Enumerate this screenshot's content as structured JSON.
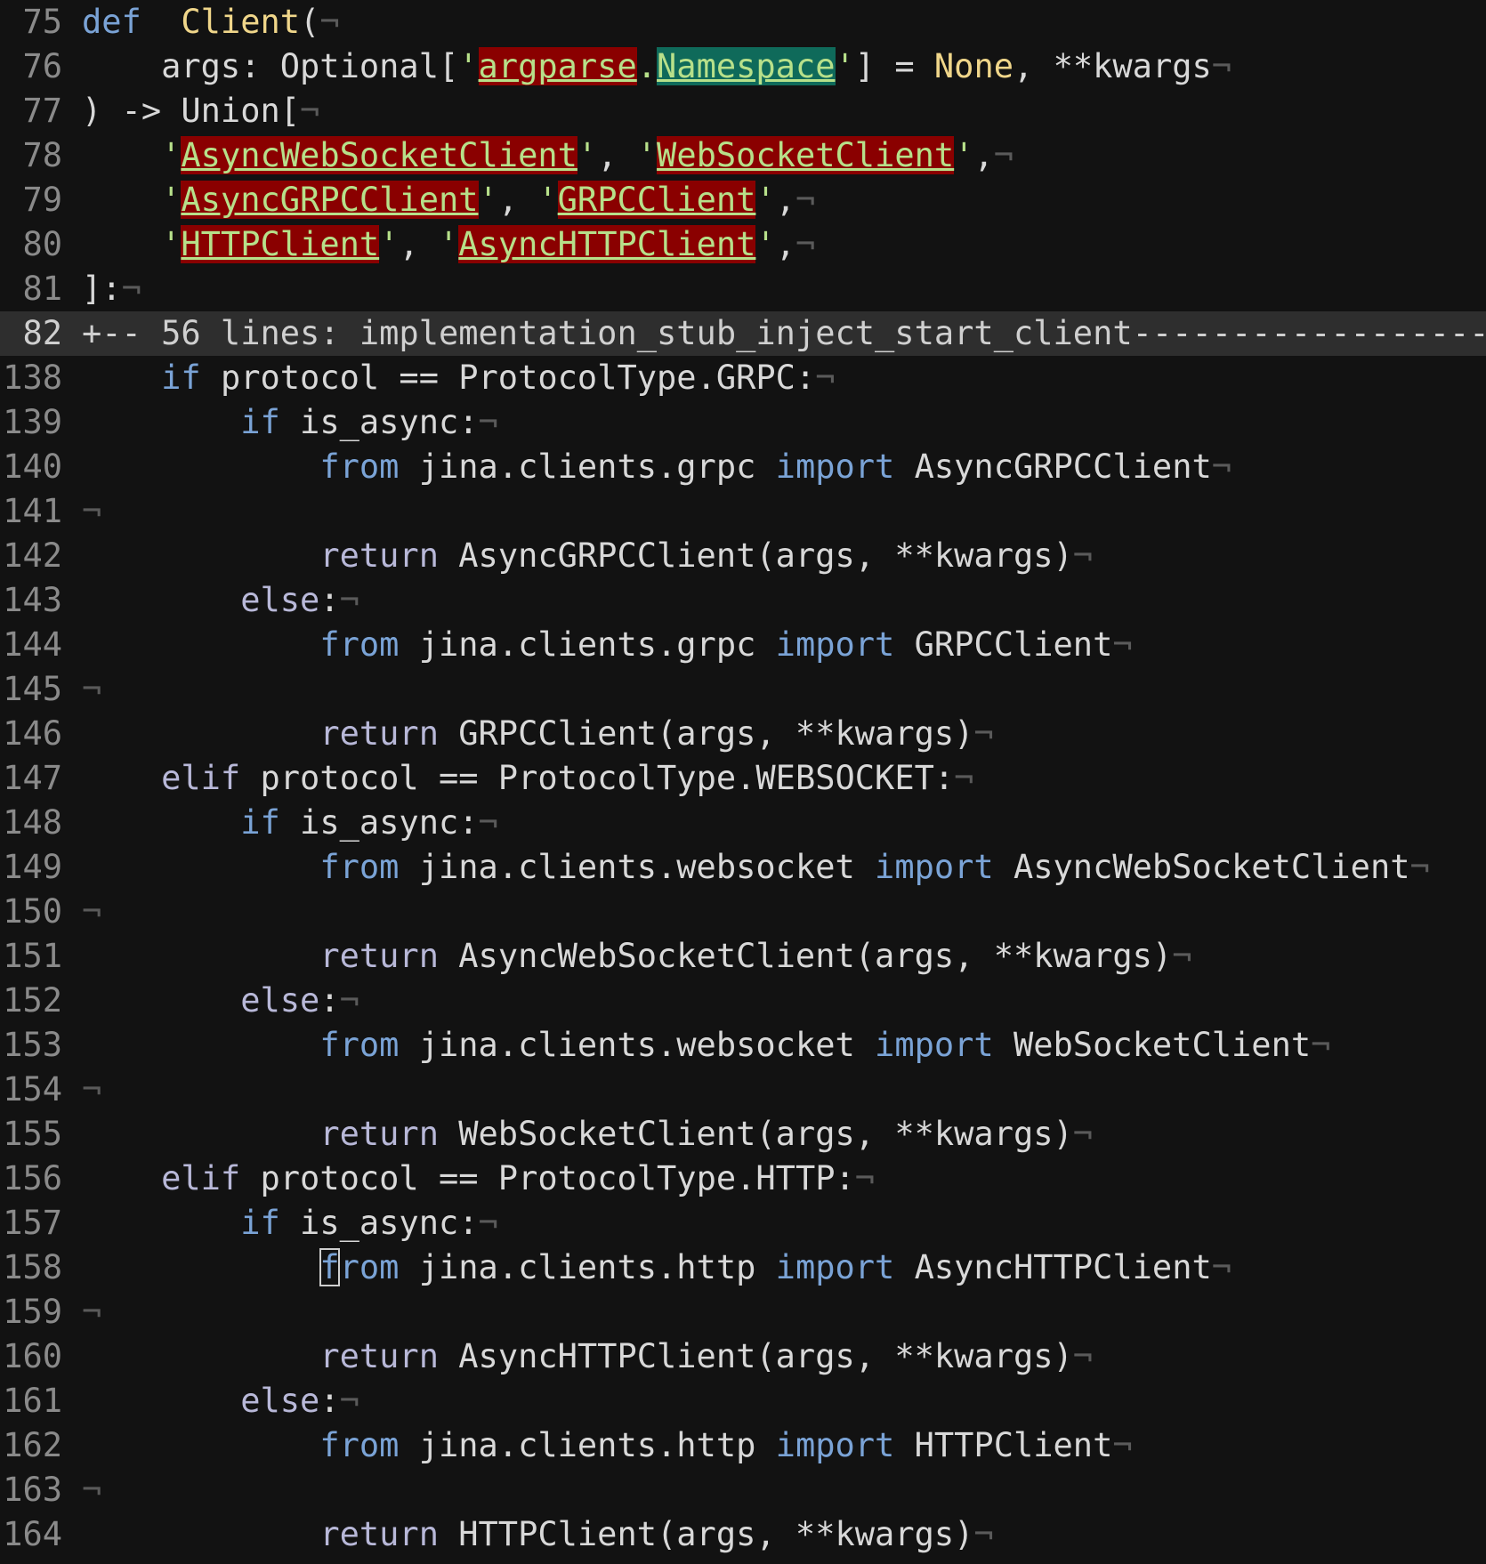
{
  "eol_char": "¬",
  "lines": [
    {
      "n": "75",
      "segs": [
        [
          "kw",
          "def"
        ],
        [
          "",
          "  "
        ],
        [
          "fn",
          "Client"
        ],
        [
          "",
          "("
        ]
      ]
    },
    {
      "n": "76",
      "segs": [
        [
          "",
          "    args: Optional["
        ],
        [
          "str-q",
          "'"
        ],
        [
          "err",
          "argparse"
        ],
        [
          "str-q",
          "."
        ],
        [
          "err2",
          "Namespace"
        ],
        [
          "str-q",
          "'"
        ],
        [
          "",
          "] = "
        ],
        [
          "bi",
          "None"
        ],
        [
          "",
          ", **kwargs"
        ]
      ]
    },
    {
      "n": "77",
      "segs": [
        [
          "",
          ") -> Union["
        ]
      ]
    },
    {
      "n": "78",
      "segs": [
        [
          "",
          "    "
        ],
        [
          "str-q",
          "'"
        ],
        [
          "err",
          "AsyncWebSocketClient"
        ],
        [
          "str-q",
          "'"
        ],
        [
          "",
          ", "
        ],
        [
          "str-q",
          "'"
        ],
        [
          "err",
          "WebSocketClient"
        ],
        [
          "str-q",
          "'"
        ],
        [
          "",
          ","
        ]
      ]
    },
    {
      "n": "79",
      "segs": [
        [
          "",
          "    "
        ],
        [
          "str-q",
          "'"
        ],
        [
          "err",
          "AsyncGRPCClient"
        ],
        [
          "str-q",
          "'"
        ],
        [
          "",
          ", "
        ],
        [
          "str-q",
          "'"
        ],
        [
          "err",
          "GRPCClient"
        ],
        [
          "str-q",
          "'"
        ],
        [
          "",
          ","
        ]
      ]
    },
    {
      "n": "80",
      "segs": [
        [
          "",
          "    "
        ],
        [
          "str-q",
          "'"
        ],
        [
          "err",
          "HTTPClient"
        ],
        [
          "str-q",
          "'"
        ],
        [
          "",
          ", "
        ],
        [
          "str-q",
          "'"
        ],
        [
          "err",
          "AsyncHTTPClient"
        ],
        [
          "str-q",
          "'"
        ],
        [
          "",
          ","
        ]
      ]
    },
    {
      "n": "81",
      "segs": [
        [
          "",
          "]:"
        ]
      ]
    },
    {
      "n": "82",
      "fold": true,
      "segs": [
        [
          "",
          "+-- 56 lines: implementation_stub_inject_start_client-----------------------"
        ]
      ]
    },
    {
      "n": "138",
      "segs": [
        [
          "",
          "    "
        ],
        [
          "kw",
          "if"
        ],
        [
          "",
          " protocol == ProtocolType.GRPC:"
        ]
      ]
    },
    {
      "n": "139",
      "segs": [
        [
          "",
          "        "
        ],
        [
          "kw",
          "if"
        ],
        [
          "",
          " is_async:"
        ]
      ]
    },
    {
      "n": "140",
      "segs": [
        [
          "",
          "            "
        ],
        [
          "kw",
          "from"
        ],
        [
          "",
          " jina.clients.grpc "
        ],
        [
          "kw",
          "import"
        ],
        [
          "",
          " AsyncGRPCClient"
        ]
      ]
    },
    {
      "n": "141",
      "segs": []
    },
    {
      "n": "142",
      "segs": [
        [
          "",
          "            "
        ],
        [
          "kw2",
          "return"
        ],
        [
          "",
          " AsyncGRPCClient(args, **kwargs)"
        ]
      ]
    },
    {
      "n": "143",
      "segs": [
        [
          "",
          "        "
        ],
        [
          "kw2",
          "else"
        ],
        [
          "",
          ":"
        ]
      ]
    },
    {
      "n": "144",
      "segs": [
        [
          "",
          "            "
        ],
        [
          "kw",
          "from"
        ],
        [
          "",
          " jina.clients.grpc "
        ],
        [
          "kw",
          "import"
        ],
        [
          "",
          " GRPCClient"
        ]
      ]
    },
    {
      "n": "145",
      "segs": []
    },
    {
      "n": "146",
      "segs": [
        [
          "",
          "            "
        ],
        [
          "kw2",
          "return"
        ],
        [
          "",
          " GRPCClient(args, **kwargs)"
        ]
      ]
    },
    {
      "n": "147",
      "segs": [
        [
          "",
          "    "
        ],
        [
          "kw2",
          "elif"
        ],
        [
          "",
          " protocol == ProtocolType.WEBSOCKET:"
        ]
      ]
    },
    {
      "n": "148",
      "segs": [
        [
          "",
          "        "
        ],
        [
          "kw",
          "if"
        ],
        [
          "",
          " is_async:"
        ]
      ]
    },
    {
      "n": "149",
      "segs": [
        [
          "",
          "            "
        ],
        [
          "kw",
          "from"
        ],
        [
          "",
          " jina.clients.websocket "
        ],
        [
          "kw",
          "import"
        ],
        [
          "",
          " AsyncWebSocketClient"
        ]
      ]
    },
    {
      "n": "150",
      "segs": []
    },
    {
      "n": "151",
      "segs": [
        [
          "",
          "            "
        ],
        [
          "kw2",
          "return"
        ],
        [
          "",
          " AsyncWebSocketClient(args, **kwargs)"
        ]
      ]
    },
    {
      "n": "152",
      "segs": [
        [
          "",
          "        "
        ],
        [
          "kw2",
          "else"
        ],
        [
          "",
          ":"
        ]
      ]
    },
    {
      "n": "153",
      "segs": [
        [
          "",
          "            "
        ],
        [
          "kw",
          "from"
        ],
        [
          "",
          " jina.clients.websocket "
        ],
        [
          "kw",
          "import"
        ],
        [
          "",
          " WebSocketClient"
        ]
      ]
    },
    {
      "n": "154",
      "segs": []
    },
    {
      "n": "155",
      "segs": [
        [
          "",
          "            "
        ],
        [
          "kw2",
          "return"
        ],
        [
          "",
          " WebSocketClient(args, **kwargs)"
        ]
      ]
    },
    {
      "n": "156",
      "segs": [
        [
          "",
          "    "
        ],
        [
          "kw2",
          "elif"
        ],
        [
          "",
          " protocol == ProtocolType.HTTP:"
        ]
      ]
    },
    {
      "n": "157",
      "segs": [
        [
          "",
          "        "
        ],
        [
          "kw",
          "if"
        ],
        [
          "",
          " is_async:"
        ]
      ]
    },
    {
      "n": "158",
      "segs": [
        [
          "",
          "            "
        ],
        [
          "kw cursor",
          "f"
        ],
        [
          "kw",
          "rom"
        ],
        [
          "",
          " jina.clients.http "
        ],
        [
          "kw",
          "import"
        ],
        [
          "",
          " AsyncHTTPClient"
        ]
      ]
    },
    {
      "n": "159",
      "segs": []
    },
    {
      "n": "160",
      "segs": [
        [
          "",
          "            "
        ],
        [
          "kw2",
          "return"
        ],
        [
          "",
          " AsyncHTTPClient(args, **kwargs)"
        ]
      ]
    },
    {
      "n": "161",
      "segs": [
        [
          "",
          "        "
        ],
        [
          "kw2",
          "else"
        ],
        [
          "",
          ":"
        ]
      ]
    },
    {
      "n": "162",
      "segs": [
        [
          "",
          "            "
        ],
        [
          "kw",
          "from"
        ],
        [
          "",
          " jina.clients.http "
        ],
        [
          "kw",
          "import"
        ],
        [
          "",
          " HTTPClient"
        ]
      ]
    },
    {
      "n": "163",
      "segs": []
    },
    {
      "n": "164",
      "segs": [
        [
          "",
          "            "
        ],
        [
          "kw2",
          "return"
        ],
        [
          "",
          " HTTPClient(args, **kwargs)"
        ]
      ]
    }
  ]
}
